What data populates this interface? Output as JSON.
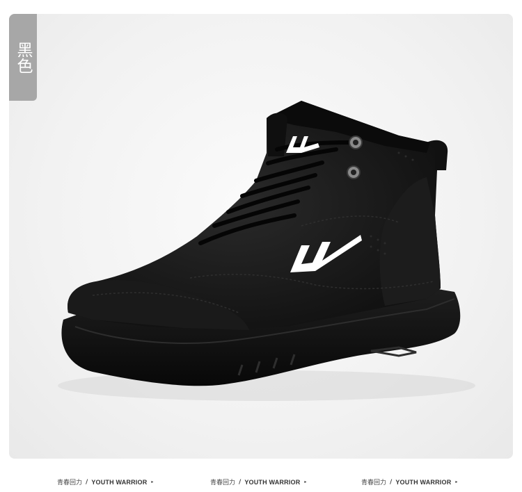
{
  "color_tag": "黑色",
  "footer": {
    "items": [
      {
        "cn": "青春回力",
        "sep": "/",
        "en": "YOUTH WARRIOR",
        "arrow": "▸"
      },
      {
        "cn": "青春回力",
        "sep": "/",
        "en": "YOUTH WARRIOR",
        "arrow": "▸"
      },
      {
        "cn": "青春回力",
        "sep": "/",
        "en": "YOUTH WARRIOR",
        "arrow": "▸"
      }
    ]
  },
  "colors": {
    "tag_bg": "#a7a7a7",
    "panel_bg": "#f2f2f2",
    "shoe": "#141414",
    "logo": "#ffffff"
  }
}
